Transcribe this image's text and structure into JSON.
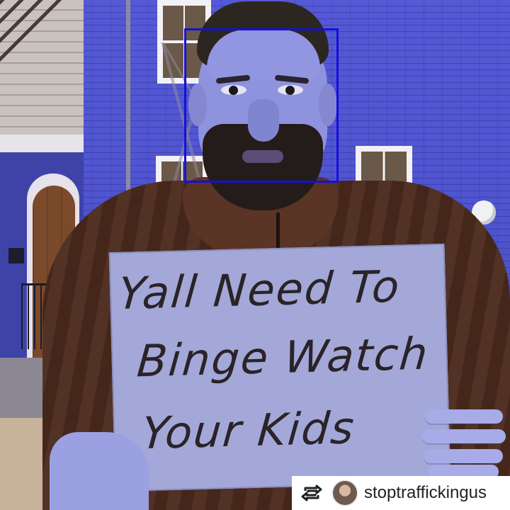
{
  "sign": {
    "line1": "Yall Need To",
    "line2": "Binge Watch",
    "line3": "Your Kids"
  },
  "repost": {
    "icon": "repost-icon",
    "avatar": "avatar",
    "handle": "stoptraffickingus"
  },
  "colors": {
    "face_box": "#1510d8",
    "wall": "#4d52cc",
    "jacket": "#4a2a1c",
    "sign": "#a4a8d8"
  }
}
